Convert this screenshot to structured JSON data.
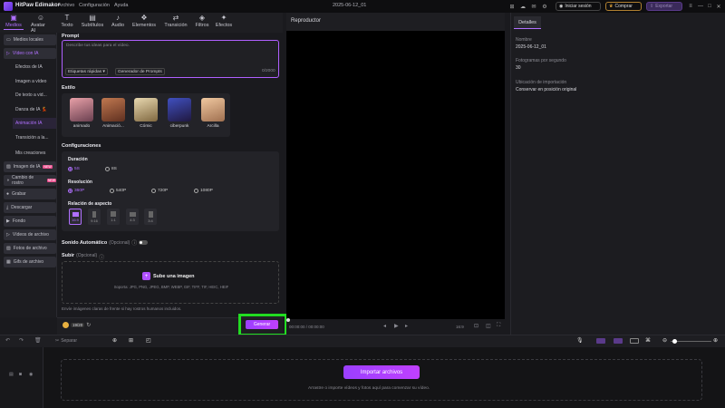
{
  "app": {
    "name": "HitPaw Edimakor",
    "title": "2025-06-12_01"
  },
  "menu": [
    "Archivo",
    "Configuración",
    "Ayuda"
  ],
  "header_buttons": {
    "login": "Iniciar sesión",
    "buy": "Comprar",
    "export": "Exportar"
  },
  "tools": [
    {
      "label": "Medios",
      "icon": "▣"
    },
    {
      "label": "Avatar AI",
      "icon": "☺"
    },
    {
      "label": "Texto",
      "icon": "T"
    },
    {
      "label": "Subtítulos",
      "icon": "▤"
    },
    {
      "label": "Audio",
      "icon": "♪"
    },
    {
      "label": "Elementos",
      "icon": "❖"
    },
    {
      "label": "Transición",
      "icon": "⇄"
    },
    {
      "label": "Filtros",
      "icon": "◈"
    },
    {
      "label": "Efectos",
      "icon": "✦"
    }
  ],
  "sidebar": {
    "items": [
      {
        "label": "Medios locales",
        "icon": "▭"
      },
      {
        "label": "Vídeo con IA",
        "icon": "▷"
      }
    ],
    "subitems": [
      "Efectos de IA",
      "Imagen a vídeo",
      "De texto a vid...",
      "Danza de IA 💃",
      "Animación IA",
      "Transición a la...",
      "Mis creaciones"
    ],
    "items2": [
      {
        "label": "Imagen de IA",
        "icon": "▨",
        "badge": "NEW"
      },
      {
        "label": "Cambio de rostro",
        "icon": "◑",
        "badge": "NEW"
      },
      {
        "label": "Grabar",
        "icon": "●"
      },
      {
        "label": "Descargar",
        "icon": "⤓"
      },
      {
        "label": "Fondo",
        "icon": "▶"
      },
      {
        "label": "Vídeos de archivo",
        "icon": "▷"
      },
      {
        "label": "Fotos de archivo",
        "icon": "▨"
      },
      {
        "label": "Gifs de archivo",
        "icon": "▦"
      }
    ]
  },
  "prompt": {
    "section": "Prompt",
    "placeholder": "Describe tus ideas para el vídeo.",
    "quick_tags": "Etiquetas rápidas",
    "generator": "Generador de Prompts",
    "counter": "0/2000"
  },
  "style": {
    "section": "Estilo",
    "items": [
      {
        "label": "animado",
        "color": "#e8a0a8"
      },
      {
        "label": "Animació...",
        "color": "#c07850"
      },
      {
        "label": "Cómic",
        "color": "#e8d8b0"
      },
      {
        "label": "ciberpunk",
        "color": "#4050c0"
      },
      {
        "label": "Arcilla",
        "color": "#f0c8a0"
      }
    ]
  },
  "config": {
    "section": "Configuraciones",
    "duration": {
      "label": "Duración",
      "options": [
        "5S",
        "8S"
      ],
      "selected": "5S"
    },
    "resolution": {
      "label": "Resolución",
      "options": [
        "360P",
        "540P",
        "720P",
        "1080P"
      ],
      "selected": "360P"
    },
    "aspect": {
      "label": "Relación de aspecto",
      "options": [
        "16:9",
        "9:16",
        "1:1",
        "4:3",
        "3:4"
      ],
      "selected": "16:9"
    }
  },
  "auto_sound": {
    "label": "Sonido Automático",
    "optional": "(Opcional)"
  },
  "upload": {
    "label": "Subir",
    "optional": "(Opcional)",
    "button": "Sube una imagen",
    "formats": "Soporta: JPG, PNG, JPEG, BMP, WEBP, GIF, TIFF, TIF, HEIC, HEIF",
    "note": "Envíe imágenes claras de frente si hay rostros humanos incluidos."
  },
  "footer": {
    "credits": "19/20",
    "generate": "Generar"
  },
  "player": {
    "title": "Reproductor",
    "time": "00:00:00 / 00:00:00",
    "ratio": "16:9"
  },
  "details": {
    "tab": "Detalles",
    "fields": [
      {
        "label": "Nombre",
        "value": "2025-06-12_01"
      },
      {
        "label": "Fotogramas por segundo",
        "value": "30"
      },
      {
        "label": "Ubicación de importación",
        "value": "Conservar en posición original"
      }
    ]
  },
  "timeline": {
    "split": "Separar",
    "import": "Importar archivos",
    "hint": "Arrastre o importe vídeos y fotos aquí para comenzar su vídeo."
  },
  "colors": {
    "accent": "#b070ff",
    "highlight": "#22dd22"
  }
}
